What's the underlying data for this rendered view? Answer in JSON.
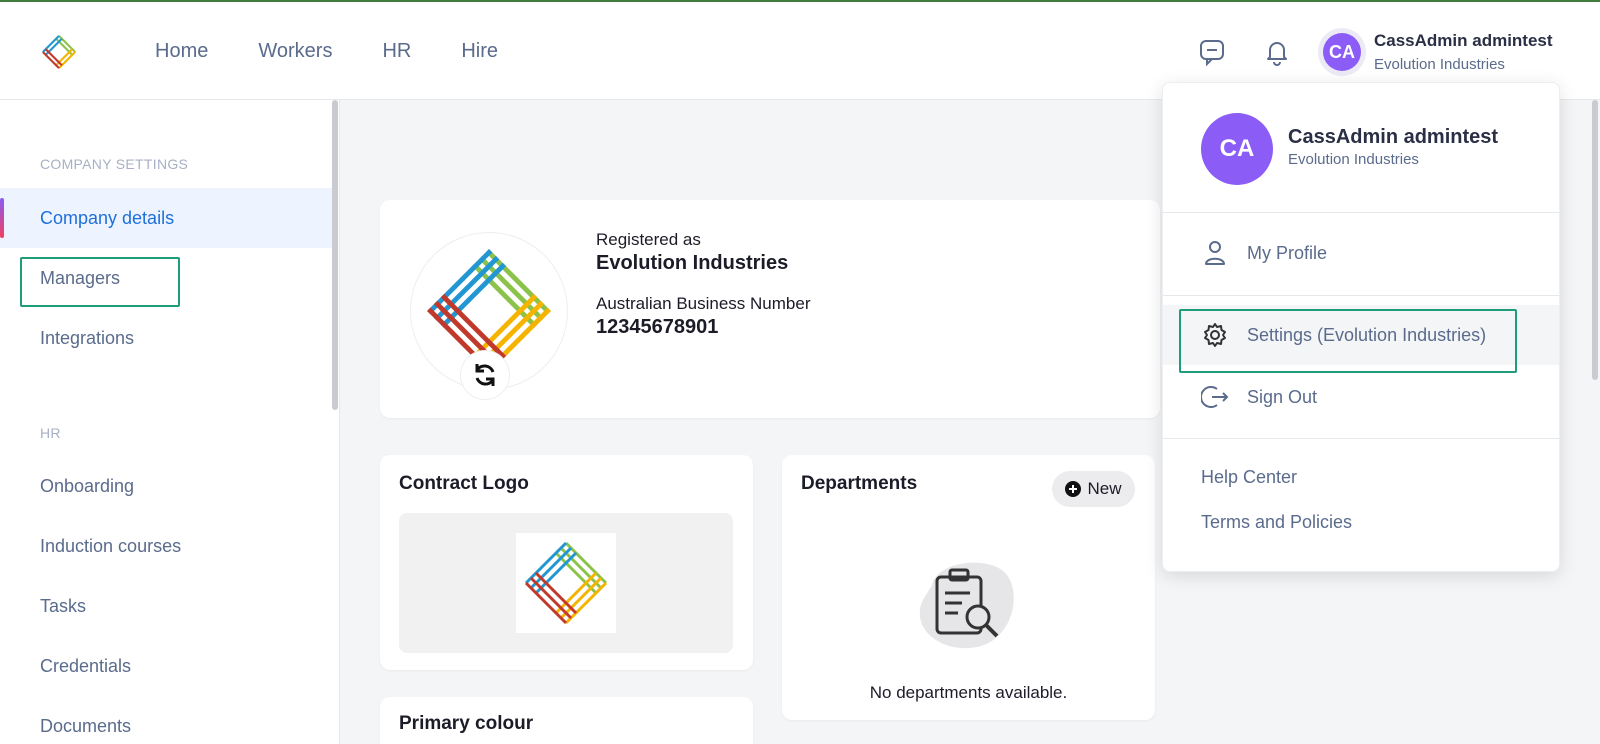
{
  "nav": {
    "items": [
      "Home",
      "Workers",
      "HR",
      "Hire"
    ]
  },
  "user": {
    "initials": "CA",
    "name": "CassAdmin admintest",
    "org": "Evolution Industries"
  },
  "sidebar": {
    "company_settings_label": "COMPANY SETTINGS",
    "company_items": [
      "Company details",
      "Managers",
      "Integrations"
    ],
    "hr_label": "HR",
    "hr_items": [
      "Onboarding",
      "Induction courses",
      "Tasks",
      "Credentials",
      "Documents"
    ]
  },
  "company": {
    "registered_label": "Registered as",
    "registered_value": "Evolution Industries",
    "abn_label": "Australian Business Number",
    "abn_value": "12345678901"
  },
  "contract_logo": {
    "title": "Contract Logo"
  },
  "departments": {
    "title": "Departments",
    "new_label": "New",
    "empty_text": "No departments available."
  },
  "primary_colour": {
    "title": "Primary colour"
  },
  "dropdown": {
    "my_profile": "My Profile",
    "settings": "Settings (Evolution Industries)",
    "sign_out": "Sign Out",
    "help_center": "Help Center",
    "terms": "Terms and Policies"
  },
  "colors": {
    "accent": "#1e6fd9",
    "avatar": "#8b5cf6",
    "highlight": "#1f9c7a"
  },
  "icons": [
    "app-logo-icon",
    "chat-icon",
    "bell-icon",
    "refresh-icon",
    "plus-circle-icon",
    "clipboard-search-icon",
    "user-icon",
    "gear-icon",
    "sign-out-icon"
  ]
}
